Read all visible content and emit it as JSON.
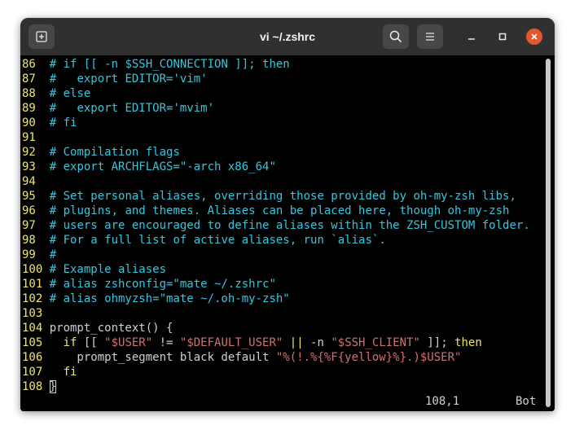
{
  "window": {
    "title": "vi ~/.zshrc"
  },
  "icons": {
    "new_tab": "new-tab-icon",
    "search": "search-icon",
    "menu": "hamburger-menu-icon",
    "minimize": "minimize-icon",
    "maximize": "maximize-icon",
    "close": "close-icon"
  },
  "colors": {
    "titlebar": "#303030",
    "terminal_bg": "#000000",
    "line_number": "#f2e65e",
    "comment": "#33c7de",
    "keyword": "#f2e65e",
    "string": "#d47070",
    "text": "#d0d0d0",
    "close_button": "#e2572b"
  },
  "editor": {
    "lines": [
      {
        "num": "86",
        "segs": [
          {
            "t": "# if [[ -n $SSH_CONNECTION ]]; then",
            "c": "c"
          }
        ]
      },
      {
        "num": "87",
        "segs": [
          {
            "t": "#   export EDITOR='vim'",
            "c": "c"
          }
        ]
      },
      {
        "num": "88",
        "segs": [
          {
            "t": "# else",
            "c": "c"
          }
        ]
      },
      {
        "num": "89",
        "segs": [
          {
            "t": "#   export EDITOR='mvim'",
            "c": "c"
          }
        ]
      },
      {
        "num": "90",
        "segs": [
          {
            "t": "# fi",
            "c": "c"
          }
        ]
      },
      {
        "num": "91",
        "segs": []
      },
      {
        "num": "92",
        "segs": [
          {
            "t": "# Compilation flags",
            "c": "c"
          }
        ]
      },
      {
        "num": "93",
        "segs": [
          {
            "t": "# export ARCHFLAGS=\"-arch x86_64\"",
            "c": "c"
          }
        ]
      },
      {
        "num": "94",
        "segs": []
      },
      {
        "num": "95",
        "segs": [
          {
            "t": "# Set personal aliases, overriding those provided by oh-my-zsh libs,",
            "c": "c"
          }
        ]
      },
      {
        "num": "96",
        "segs": [
          {
            "t": "# plugins, and themes. Aliases can be placed here, though oh-my-zsh",
            "c": "c"
          }
        ]
      },
      {
        "num": "97",
        "segs": [
          {
            "t": "# users are encouraged to define aliases within the ZSH_CUSTOM folder.",
            "c": "c"
          }
        ]
      },
      {
        "num": "98",
        "segs": [
          {
            "t": "# For a full list of active aliases, run `alias`.",
            "c": "c"
          }
        ]
      },
      {
        "num": "99",
        "segs": [
          {
            "t": "#",
            "c": "c"
          }
        ]
      },
      {
        "num": "100",
        "segs": [
          {
            "t": "# Example aliases",
            "c": "c"
          }
        ]
      },
      {
        "num": "101",
        "segs": [
          {
            "t": "# alias zshconfig=\"mate ~/.zshrc\"",
            "c": "c"
          }
        ]
      },
      {
        "num": "102",
        "segs": [
          {
            "t": "# alias ohmyzsh=\"mate ~/.oh-my-zsh\"",
            "c": "c"
          }
        ]
      },
      {
        "num": "103",
        "segs": []
      },
      {
        "num": "104",
        "segs": [
          {
            "t": "prompt_context() {",
            "c": "w"
          }
        ]
      },
      {
        "num": "105",
        "segs": [
          {
            "t": "  ",
            "c": "w"
          },
          {
            "t": "if",
            "c": "y"
          },
          {
            "t": " [[ ",
            "c": "w"
          },
          {
            "t": "\"$USER\"",
            "c": "s"
          },
          {
            "t": " != ",
            "c": "w"
          },
          {
            "t": "\"$DEFAULT_USER\"",
            "c": "s"
          },
          {
            "t": " ",
            "c": "w"
          },
          {
            "t": "||",
            "c": "y"
          },
          {
            "t": " -n ",
            "c": "w"
          },
          {
            "t": "\"$SSH_CLIENT\"",
            "c": "s"
          },
          {
            "t": " ]]; ",
            "c": "w"
          },
          {
            "t": "then",
            "c": "y"
          }
        ]
      },
      {
        "num": "106",
        "segs": [
          {
            "t": "    prompt_segment black default ",
            "c": "w"
          },
          {
            "t": "\"%(!.%{%F{yellow}%}.)$USER\"",
            "c": "s"
          }
        ]
      },
      {
        "num": "107",
        "segs": [
          {
            "t": "  ",
            "c": "w"
          },
          {
            "t": "fi",
            "c": "y"
          }
        ]
      },
      {
        "num": "108",
        "segs": [
          {
            "t": "}",
            "c": "w",
            "cursor": true
          }
        ]
      }
    ],
    "status": {
      "position": "108,1",
      "scroll": "Bot"
    }
  }
}
